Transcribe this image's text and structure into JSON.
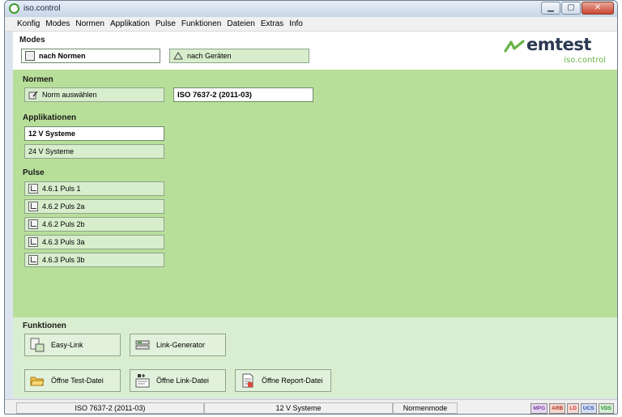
{
  "window": {
    "title": "iso.control"
  },
  "menu": [
    "Konfig",
    "Modes",
    "Normen",
    "Applikation",
    "Pulse",
    "Funktionen",
    "Dateien",
    "Extras",
    "Info"
  ],
  "modes": {
    "title": "Modes",
    "by_norms": "nach Normen",
    "by_devices": "nach Geräten"
  },
  "logo": {
    "brand": "emtest",
    "sub": "iso.control",
    "accent": "#6ab34a",
    "text_color": "#2b3a52"
  },
  "normen": {
    "title": "Normen",
    "select_button": "Norm auswählen",
    "selected_value": "ISO 7637-2 (2011-03)"
  },
  "applikationen": {
    "title": "Applikationen",
    "items": [
      {
        "label": "12 V Systeme",
        "selected": true
      },
      {
        "label": "24 V Systeme",
        "selected": false
      }
    ]
  },
  "pulse": {
    "title": "Pulse",
    "items": [
      {
        "label": "4.6.1 Puls 1",
        "icon": "pulse-1-icon"
      },
      {
        "label": "4.6.2 Puls 2a",
        "icon": "pulse-2a-icon"
      },
      {
        "label": "4.6.2 Puls 2b",
        "icon": "pulse-2b-icon"
      },
      {
        "label": "4.6.3 Puls 3a",
        "icon": "pulse-3a-icon"
      },
      {
        "label": "4.6.3 Puls 3b",
        "icon": "pulse-3b-icon"
      }
    ]
  },
  "funktionen": {
    "title": "Funktionen",
    "easy_link": "Easy-Link",
    "link_generator": "Link-Generator",
    "open_test": "Öffne Test-Datei",
    "open_link": "Öffne Link-Datei",
    "open_report": "Öffne Report-Datei"
  },
  "status": {
    "norm": "ISO 7637-2 (2011-03)",
    "system": "12 V Systeme",
    "mode": "Normenmode",
    "badges": [
      {
        "label": "MPG",
        "color": "#7a3fa0"
      },
      {
        "label": "ARB",
        "color": "#b3321f"
      },
      {
        "label": "LD",
        "color": "#d04030"
      },
      {
        "label": "UCS",
        "color": "#2a4fb0"
      },
      {
        "label": "VDS",
        "color": "#2d8a35"
      }
    ]
  },
  "colors": {
    "green_panel": "#b8df9a",
    "light_green": "#d9eed0"
  }
}
